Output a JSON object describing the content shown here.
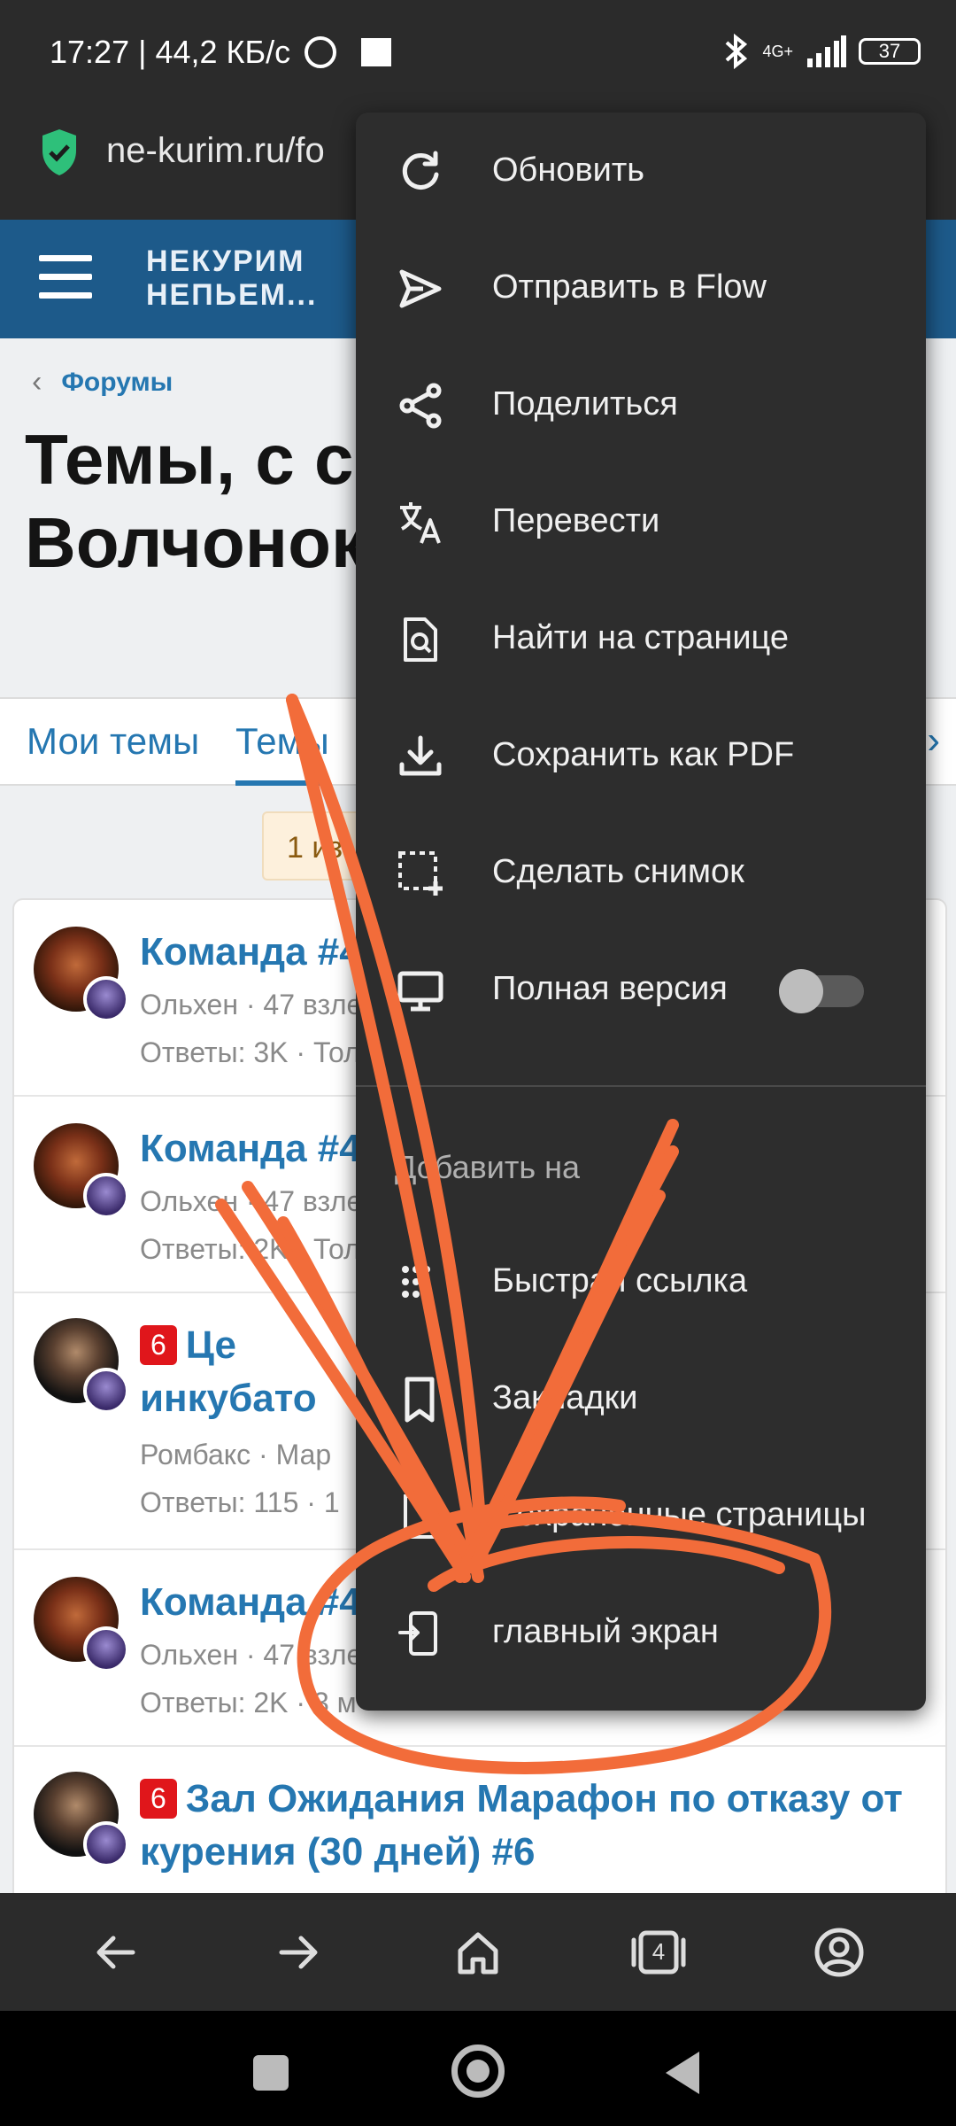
{
  "status_bar": {
    "time_speed": "17:27 | 44,2 КБ/с",
    "network": "4G+",
    "battery": "37"
  },
  "url_bar": {
    "url": "ne-kurim.ru/fo"
  },
  "site_header": {
    "logo_line1": "НЕКУРИМ",
    "logo_line2": "НЕПЬЕМ..."
  },
  "page": {
    "breadcrumb": "Форумы",
    "title": "Темы, с со пользоват Волчонок",
    "tabs": [
      "Мои темы",
      "Темы"
    ],
    "pager": "1 из"
  },
  "threads": [
    {
      "title": "Команда #4",
      "meta": "Ольхен · 47 взле",
      "stats": "Ответы: 3K · Тол"
    },
    {
      "title": "Команда #4",
      "meta": "Ольхен · 47 взле",
      "stats": "Ответы: 2K · Тол"
    },
    {
      "badge": "6",
      "title_line1": "Це",
      "title_line2": "инкубато",
      "meta": "Ромбакс · Мар",
      "stats": "Ответы: 115 · 1"
    },
    {
      "title": "Команда #4",
      "meta": "Ольхен · 47 взле",
      "stats": "Ответы: 2K · 3 м"
    },
    {
      "badge": "6",
      "title_line1": "Зал Ожидания Марафон по отказу от",
      "title_line2": "курения (30 дней) #6"
    }
  ],
  "menu": {
    "items": [
      {
        "label": "Обновить",
        "icon": "refresh-icon"
      },
      {
        "label": "Отправить в Flow",
        "icon": "send-icon"
      },
      {
        "label": "Поделиться",
        "icon": "share-icon"
      },
      {
        "label": "Перевести",
        "icon": "translate-icon"
      },
      {
        "label": "Найти на странице",
        "icon": "find-in-page-icon"
      },
      {
        "label": "Сохранить как PDF",
        "icon": "download-icon"
      },
      {
        "label": "Сделать снимок",
        "icon": "screenshot-icon"
      },
      {
        "label": "Полная версия",
        "icon": "desktop-icon",
        "toggle": false
      }
    ],
    "section_label": "Добавить на",
    "add_items": [
      {
        "label": "Быстрая ссылка",
        "icon": "quick-link-icon"
      },
      {
        "label": "Закладки",
        "icon": "bookmark-icon"
      },
      {
        "label": "Сохраненные страницы",
        "icon": "saved-pages-icon"
      },
      {
        "label": "главный экран",
        "icon": "add-to-home-icon"
      }
    ]
  },
  "browser_nav": {
    "tab_count": "4"
  },
  "colors": {
    "accent": "#2577b1",
    "header_bg": "#1d5a8a",
    "menu_bg": "#2d2d2d",
    "annotation": "#f26c3a",
    "secure": "#2ec07a"
  }
}
